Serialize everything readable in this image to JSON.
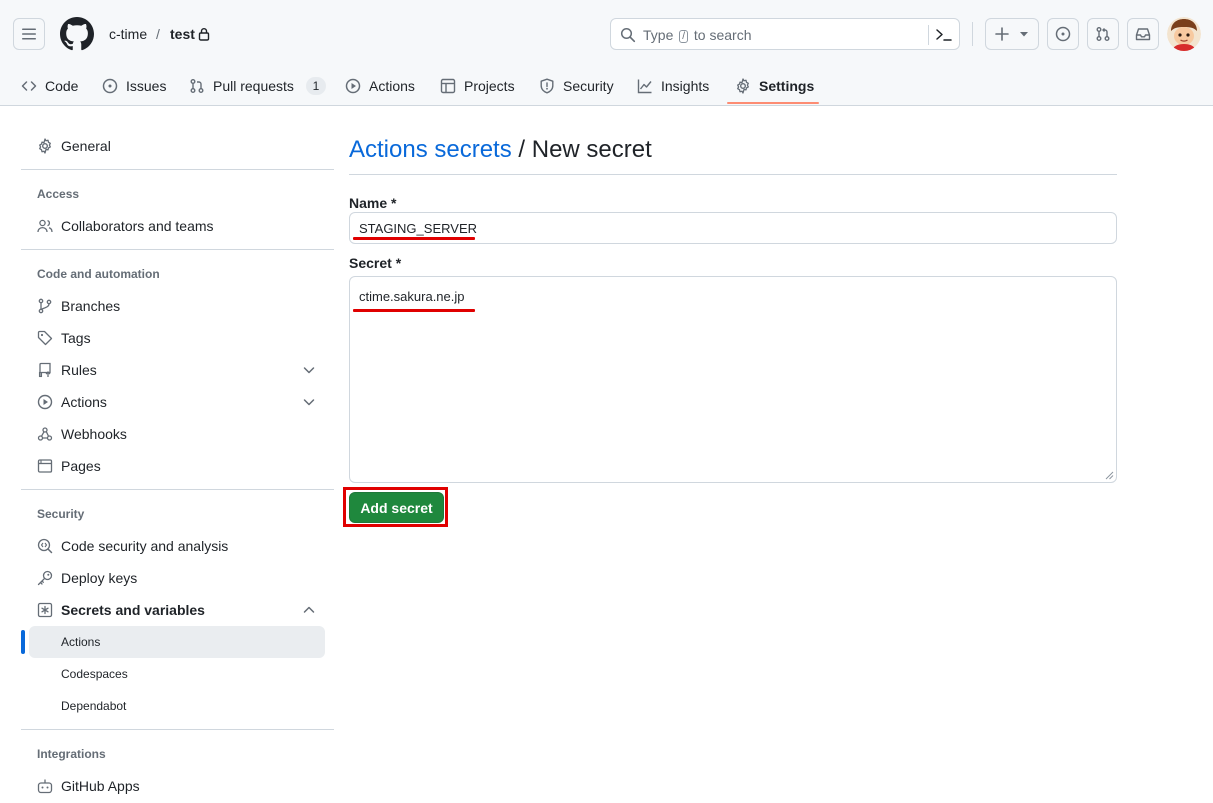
{
  "header": {
    "owner": "c-time",
    "separator": "/",
    "repo": "test",
    "search_prefix": "Type",
    "search_key": "/",
    "search_suffix": "to search"
  },
  "tabs": [
    {
      "label": "Code",
      "icon": "code-icon"
    },
    {
      "label": "Issues",
      "icon": "issue-opened-icon"
    },
    {
      "label": "Pull requests",
      "icon": "git-pull-request-icon",
      "count": "1"
    },
    {
      "label": "Actions",
      "icon": "play-icon"
    },
    {
      "label": "Projects",
      "icon": "table-icon"
    },
    {
      "label": "Security",
      "icon": "shield-icon"
    },
    {
      "label": "Insights",
      "icon": "graph-icon"
    },
    {
      "label": "Settings",
      "icon": "gear-icon",
      "selected": true
    }
  ],
  "sidebar": {
    "general": "General",
    "access_heading": "Access",
    "collaborators": "Collaborators and teams",
    "code_heading": "Code and automation",
    "branches": "Branches",
    "tags": "Tags",
    "rules": "Rules",
    "actions": "Actions",
    "webhooks": "Webhooks",
    "pages": "Pages",
    "security_heading": "Security",
    "code_security": "Code security and analysis",
    "deploy_keys": "Deploy keys",
    "secrets": "Secrets and variables",
    "secrets_actions": "Actions",
    "secrets_codespaces": "Codespaces",
    "secrets_dependabot": "Dependabot",
    "integrations_heading": "Integrations",
    "github_apps": "GitHub Apps"
  },
  "main": {
    "title_link": "Actions secrets",
    "title_rest": " / New secret",
    "name_label": "Name *",
    "name_value": "STAGING_SERVER",
    "secret_label": "Secret *",
    "secret_value": "ctime.sakura.ne.jp",
    "add_button": "Add secret"
  },
  "colors": {
    "accent_link": "#0969da",
    "primary_button": "#1f883d",
    "selected_tab_underline": "#fd8c73",
    "annotation_red": "#e00000"
  }
}
